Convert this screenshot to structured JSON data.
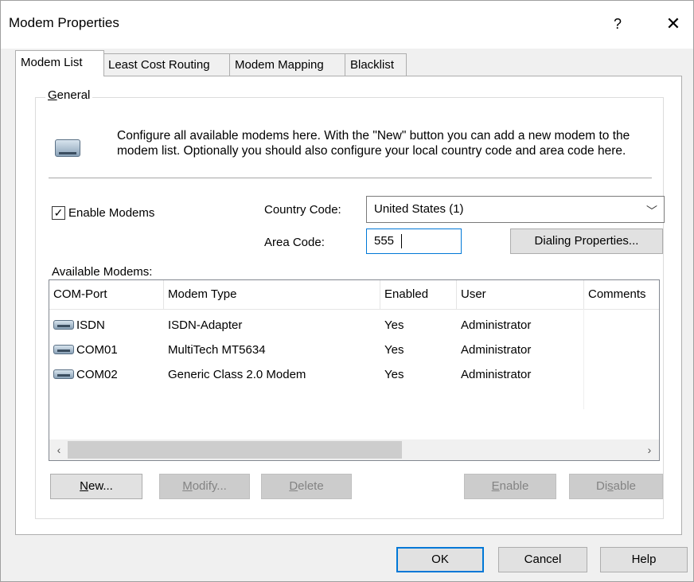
{
  "window": {
    "title": "Modem Properties",
    "help_glyph": "?",
    "close_glyph": "✕"
  },
  "tabs": [
    {
      "label": "Modem List",
      "active": true
    },
    {
      "label": "Least Cost Routing",
      "active": false
    },
    {
      "label": "Modem Mapping",
      "active": false
    },
    {
      "label": "Blacklist",
      "active": false
    }
  ],
  "general": {
    "group_label_underlined": "G",
    "group_label_rest": "eneral",
    "icon": "modem-icon",
    "description": "Configure all available modems here. With the \"New\" button you can add a new modem to the modem list. Optionally you should also configure your local country code and area code here."
  },
  "form": {
    "enable_modems_label": "Enable Modems",
    "enable_modems_checked": true,
    "check_glyph": "✓",
    "country_code_label": "Country Code:",
    "country_code_value": "United States (1)",
    "dropdown_glyph": "﹀",
    "area_code_label": "Area Code:",
    "area_code_value": "555",
    "dialing_properties_label": "Dialing Properties..."
  },
  "modems": {
    "label": "Available Modems:",
    "columns": [
      "COM-Port",
      "Modem Type",
      "Enabled",
      "User",
      "Comments"
    ],
    "rows": [
      {
        "port": "ISDN",
        "type": "ISDN-Adapter",
        "enabled": "Yes",
        "user": "Administrator",
        "comments": ""
      },
      {
        "port": "COM01",
        "type": "MultiTech MT5634",
        "enabled": "Yes",
        "user": "Administrator",
        "comments": ""
      },
      {
        "port": "COM02",
        "type": "Generic Class 2.0 Modem",
        "enabled": "Yes",
        "user": "Administrator",
        "comments": ""
      }
    ],
    "scroll_left_glyph": "‹",
    "scroll_right_glyph": "›"
  },
  "buttons": {
    "new_u": "N",
    "new_rest": "ew...",
    "modify_u": "M",
    "modify_rest": "odify...",
    "delete_u": "D",
    "delete_rest": "elete",
    "enable_u": "E",
    "enable_rest": "nable",
    "disable_pre": "Di",
    "disable_u": "s",
    "disable_rest": "able",
    "ok": "OK",
    "cancel": "Cancel",
    "help": "Help"
  },
  "colors": {
    "accent": "#0078d7",
    "disabled_text": "#838383"
  }
}
